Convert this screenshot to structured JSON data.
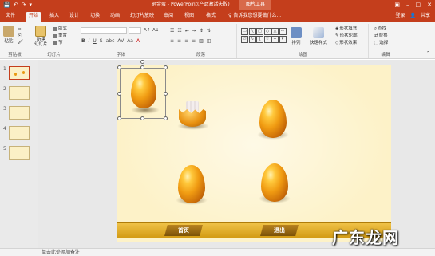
{
  "titlebar": {
    "title": "砸金蛋 - PowerPoint(产品激活失败)",
    "context_tools": "图片工具",
    "qat": [
      "💾",
      "↶",
      "↷",
      "▾"
    ]
  },
  "tabs": [
    {
      "label": "文件"
    },
    {
      "label": "开始"
    },
    {
      "label": "插入"
    },
    {
      "label": "设计"
    },
    {
      "label": "切换"
    },
    {
      "label": "动画"
    },
    {
      "label": "幻灯片放映"
    },
    {
      "label": "审阅"
    },
    {
      "label": "视图"
    },
    {
      "label": "格式"
    }
  ],
  "search_placeholder": "告诉我您想要做什么...",
  "account": {
    "signin": "登录",
    "share": "共享"
  },
  "ribbon": {
    "clipboard": {
      "paste": "粘贴",
      "label": "剪贴板"
    },
    "slides": {
      "new_slide": "新建\n幻灯片",
      "layout": "版式",
      "reset": "重置",
      "section": "节",
      "label": "幻灯片"
    },
    "font": {
      "label": "字体"
    },
    "paragraph": {
      "label": "段落"
    },
    "drawing": {
      "arrange": "排列",
      "quick_styles": "快速样式",
      "fill": "形状填充",
      "outline": "形状轮廓",
      "effects": "形状效果",
      "label": "绘图"
    },
    "editing": {
      "find": "查找",
      "replace": "替换",
      "select": "选择",
      "label": "编辑"
    }
  },
  "thumbnails": [
    {
      "num": "1"
    },
    {
      "num": "2"
    },
    {
      "num": "3"
    },
    {
      "num": "4"
    },
    {
      "num": "5"
    }
  ],
  "slide": {
    "buttons": {
      "home": "首页",
      "exit": "退出"
    }
  },
  "notes_placeholder": "单击此处添加备注",
  "watermark": "广东龙网",
  "colors": {
    "accent": "#c43e1c",
    "slide_bg": "#fdf2c8",
    "gold": "#f09b12"
  }
}
